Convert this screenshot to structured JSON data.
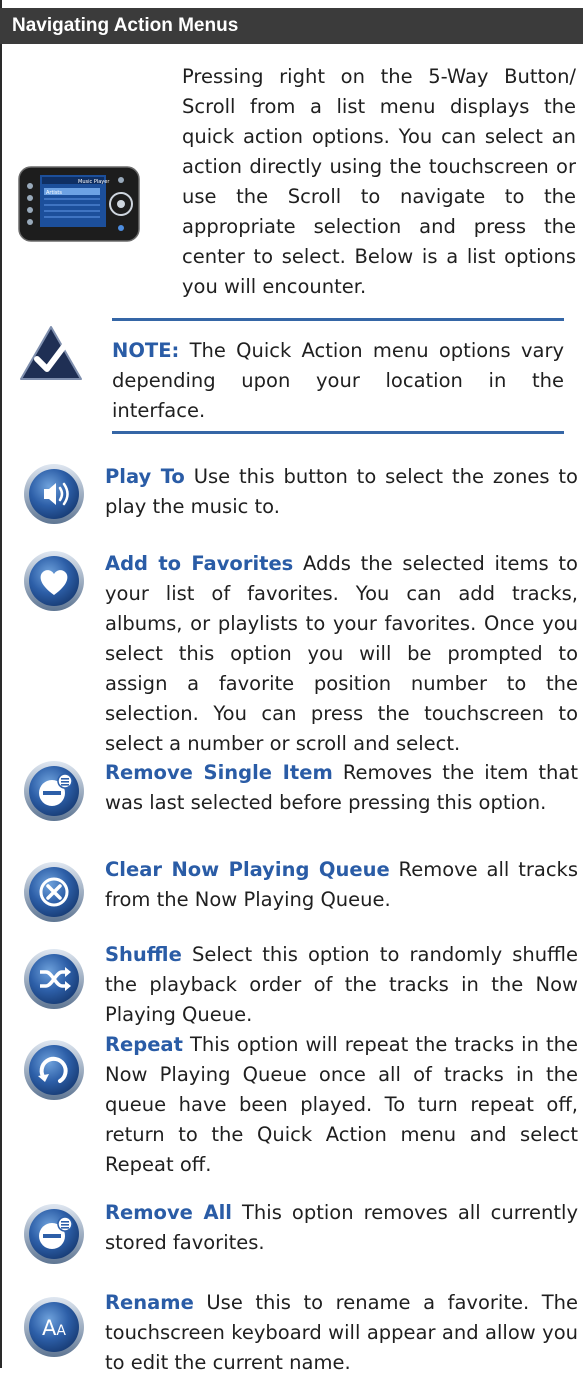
{
  "header": {
    "title": "Navigating Action Menus"
  },
  "intro": {
    "text": "Pressing right on the 5-Way Button/ Scroll from a list menu displays the quick action options. You can select an action directly using the touchscreen or use the Scroll to navigate to the appropriate selection and press the center to select. Below is a list options you will encounter."
  },
  "note": {
    "label": "NOTE:",
    "text": " The Quick Action menu options vary depending upon your location in the interface."
  },
  "items": [
    {
      "title": "Play To",
      "text": " Use this button to select the zones to play the music to.",
      "icon": "speaker-icon"
    },
    {
      "title": "Add to Favorites",
      "text": " Adds the selected items to your list of favorites. You can add tracks, albums, or playlists to your favorites. Once you select this option you will be prompted to assign a favorite position number to the selection. You can press the touchscreen to select a number or scroll and select.",
      "icon": "heart-icon"
    },
    {
      "title": "Remove Single Item",
      "text": " Removes the item that was last selected before pressing this option.",
      "icon": "remove-item-icon"
    },
    {
      "title": "Clear Now Playing Queue",
      "text": " Remove all tracks from the Now Playing Queue.",
      "icon": "clear-icon"
    },
    {
      "title": "Shuffle",
      "text": " Select this option to randomly shuffle the playback order of the tracks in the Now Playing Queue.",
      "icon": "shuffle-icon"
    },
    {
      "title": "Repeat",
      "text": " This option will repeat the tracks in the Now Playing Queue once all of tracks in the queue have been played. To turn repeat off, return to the Quick Action menu and select Repeat off.",
      "icon": "repeat-icon"
    },
    {
      "title": "Remove All",
      "text": " This option removes all currently stored favorites.",
      "icon": "remove-all-icon"
    },
    {
      "title": "Rename",
      "text": " Use this to rename a favorite. The touchscreen keyboard will appear and allow you to edit the current name.",
      "icon": "rename-icon"
    }
  ],
  "device_screen": {
    "title": "Music Player",
    "row1": "Artists"
  },
  "colors": {
    "accent": "#2a5ca6",
    "header_bg": "#3b3b3b",
    "rule": "#3566a6"
  }
}
